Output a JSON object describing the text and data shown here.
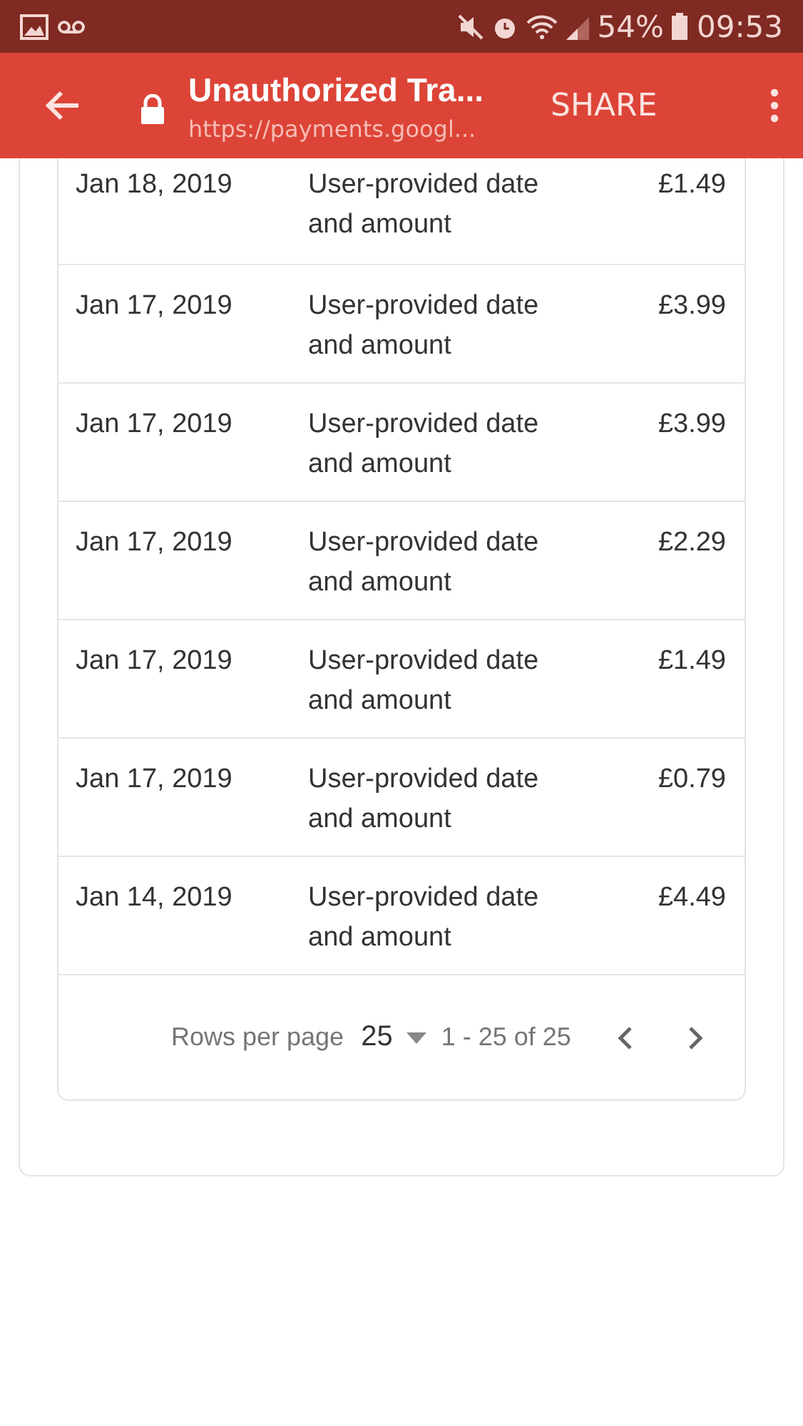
{
  "status_bar": {
    "battery": "54%",
    "time": "09:53"
  },
  "app_bar": {
    "title": "Unauthorized Tra...",
    "url": "https://payments.googl...",
    "action": "SHARE"
  },
  "table": {
    "rows": [
      {
        "date": "Jan 18, 2019",
        "description": "User-provided date and amount",
        "amount": "£1.49"
      },
      {
        "date": "Jan 17, 2019",
        "description": "User-provided date and amount",
        "amount": "£3.99"
      },
      {
        "date": "Jan 17, 2019",
        "description": "User-provided date and amount",
        "amount": "£3.99"
      },
      {
        "date": "Jan 17, 2019",
        "description": "User-provided date and amount",
        "amount": "£2.29"
      },
      {
        "date": "Jan 17, 2019",
        "description": "User-provided date and amount",
        "amount": "£1.49"
      },
      {
        "date": "Jan 17, 2019",
        "description": "User-provided date and amount",
        "amount": "£0.79"
      },
      {
        "date": "Jan 14, 2019",
        "description": "User-provided date and amount",
        "amount": "£4.49"
      }
    ]
  },
  "pagination": {
    "rows_per_page_label": "Rows per page",
    "rows_per_page": "25",
    "range": "1 - 25 of 25"
  }
}
